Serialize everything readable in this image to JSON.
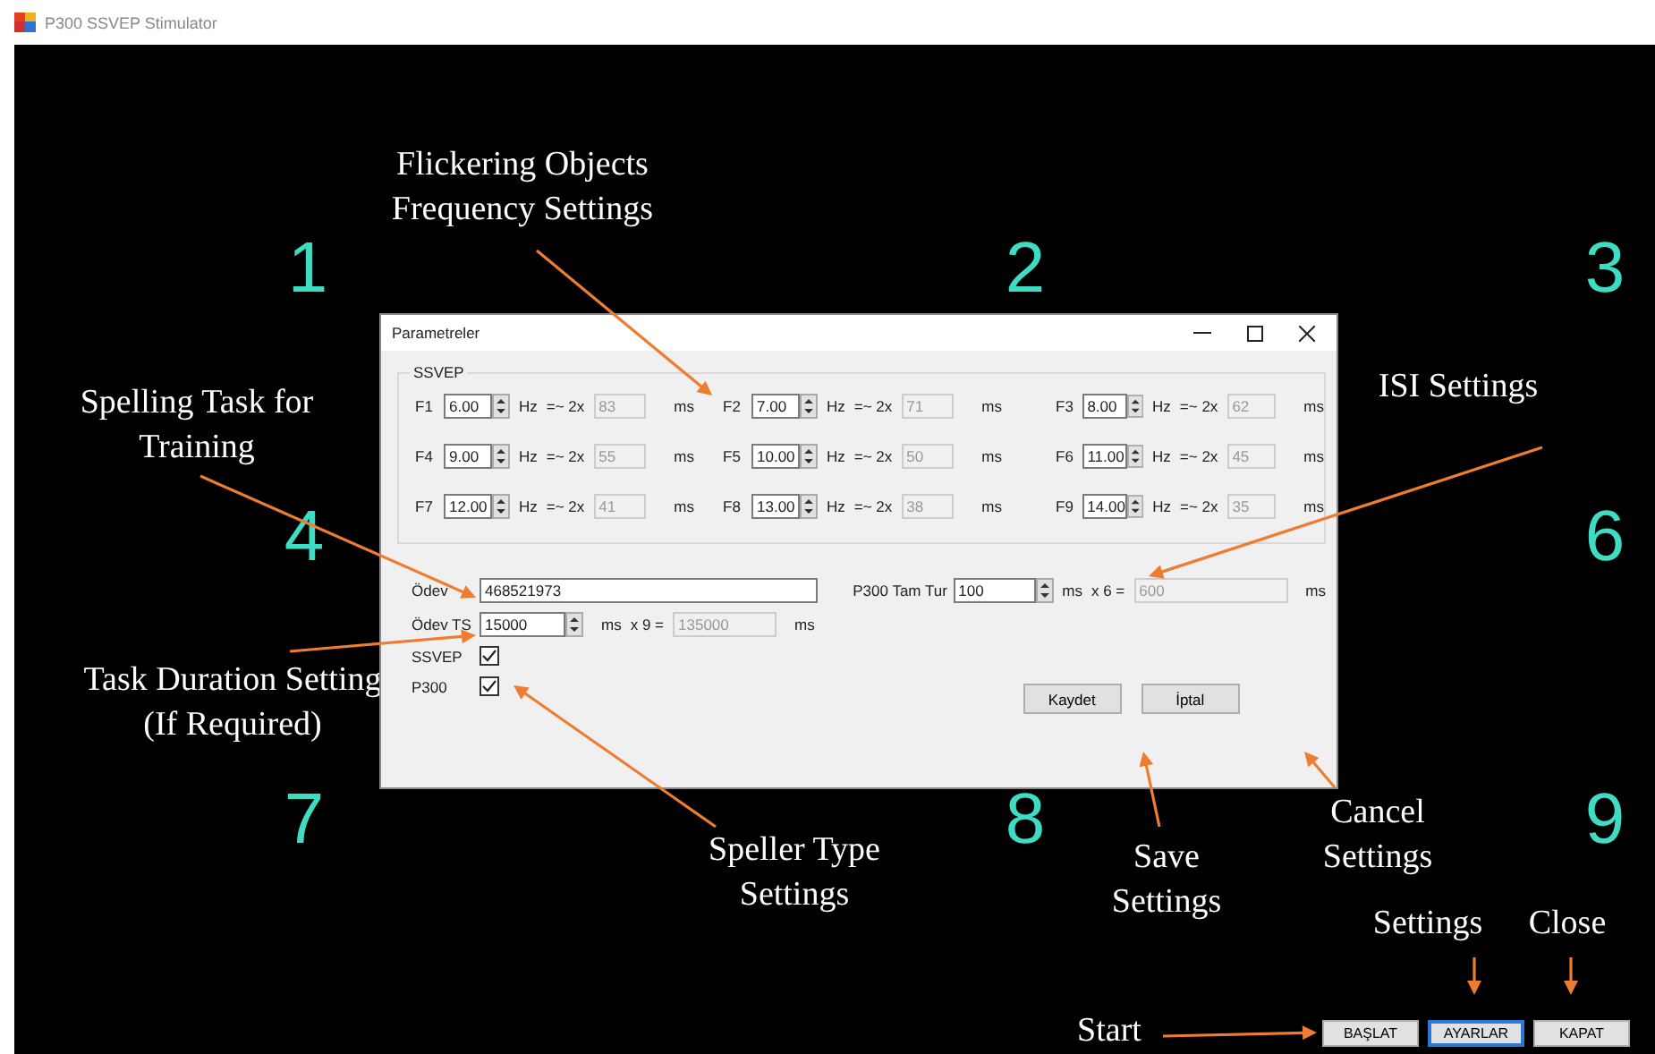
{
  "window": {
    "title": "P300 SSVEP Stimulator"
  },
  "section_numbers": [
    "1",
    "2",
    "3",
    "4",
    "6",
    "7",
    "8",
    "9"
  ],
  "annotations": [
    "Flickering Objects Frequency Settings",
    "Spelling Task for Training",
    "ISI Settings",
    "Task Duration Setting (If Required)",
    "Speller Type Settings",
    "Save Settings",
    "Cancel Settings",
    "Settings",
    "Close",
    "Start"
  ],
  "dialog": {
    "title": "Parametreler",
    "ssvep_group": {
      "title": "SSVEP",
      "channels": [
        {
          "label": "F1",
          "value": "6.00",
          "unit": "Hz",
          "relation": "=~ 2x",
          "period": "83",
          "period_unit": "ms"
        },
        {
          "label": "F2",
          "value": "7.00",
          "unit": "Hz",
          "relation": "=~ 2x",
          "period": "71",
          "period_unit": "ms"
        },
        {
          "label": "F3",
          "value": "8.00",
          "unit": "Hz",
          "relation": "=~ 2x",
          "period": "62",
          "period_unit": "ms"
        },
        {
          "label": "F4",
          "value": "9.00",
          "unit": "Hz",
          "relation": "=~ 2x",
          "period": "55",
          "period_unit": "ms"
        },
        {
          "label": "F5",
          "value": "10.00",
          "unit": "Hz",
          "relation": "=~ 2x",
          "period": "50",
          "period_unit": "ms"
        },
        {
          "label": "F6",
          "value": "11.00",
          "unit": "Hz",
          "relation": "=~ 2x",
          "period": "45",
          "period_unit": "ms"
        },
        {
          "label": "F7",
          "value": "12.00",
          "unit": "Hz",
          "relation": "=~ 2x",
          "period": "41",
          "period_unit": "ms"
        },
        {
          "label": "F8",
          "value": "13.00",
          "unit": "Hz",
          "relation": "=~ 2x",
          "period": "38",
          "period_unit": "ms"
        },
        {
          "label": "F9",
          "value": "14.00",
          "unit": "Hz",
          "relation": "=~ 2x",
          "period": "35",
          "period_unit": "ms"
        }
      ]
    },
    "task": {
      "label": "Ödev",
      "value": "468521973"
    },
    "task_duration": {
      "label": "Ödev TS",
      "value": "15000",
      "unit": "ms",
      "multiplier": "x 9 =",
      "result": "135000",
      "result_unit": "ms"
    },
    "isi": {
      "label": "P300 Tam Tur",
      "value": "100",
      "unit": "ms",
      "multiplier": "x 6 =",
      "result": "600",
      "result_unit": "ms"
    },
    "speller_types": [
      {
        "label": "SSVEP",
        "checked": true
      },
      {
        "label": "P300",
        "checked": true
      }
    ],
    "buttons": [
      "Kaydet",
      "İptal"
    ]
  },
  "main_buttons": [
    {
      "label": "BAŞLAT",
      "selected": false
    },
    {
      "label": "AYARLAR",
      "selected": true
    },
    {
      "label": "KAPAT",
      "selected": false
    }
  ]
}
